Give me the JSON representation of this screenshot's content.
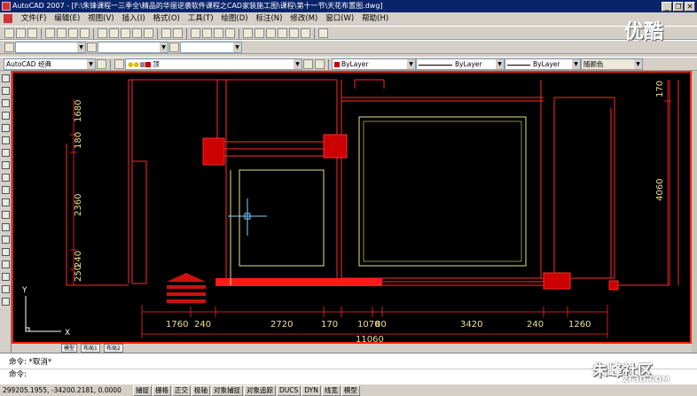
{
  "window": {
    "title": "AutoCAD 2007 - [F:\\朱锋课程一三季全\\精品的华丽逆袭软件课程之CAD家装施工图\\课程\\第十一节\\天花布置图.dwg]",
    "minimize_glyph": "_",
    "restore_glyph": "❐",
    "close_glyph": "✕"
  },
  "menu": {
    "items": [
      "文件(F)",
      "编辑(E)",
      "视图(V)",
      "插入(I)",
      "格式(O)",
      "工具(T)",
      "绘图(D)",
      "标注(N)",
      "修改(M)",
      "窗口(W)",
      "帮助(H)"
    ]
  },
  "properties_bar": {
    "workspace": "AutoCAD 经典",
    "layer": "顶",
    "color": "ByLayer",
    "linetype": "ByLayer",
    "lineweight": "ByLayer",
    "plotstyle": "随颜色",
    "layer_color": "#cc0000"
  },
  "drawing": {
    "dims_left": [
      "1680",
      "180",
      "2360",
      "240",
      "250"
    ],
    "dims_right": [
      "170",
      "4060"
    ],
    "dims_bottom": [
      "1760",
      "240",
      "2720",
      "170",
      "1070",
      "80",
      "3420",
      "240",
      "1260"
    ],
    "total_width": "11060",
    "ucs_x": "X",
    "ucs_y": "Y"
  },
  "tabs": [
    "模型",
    "布局1",
    "布局2"
  ],
  "command": {
    "history": "命令: *取消*",
    "prompt": "命令:"
  },
  "status": {
    "coordinates": "299205.1955, -34200.2181, 0.0000",
    "buttons": [
      "捕捉",
      "栅格",
      "正交",
      "极轴",
      "对象捕捉",
      "对象追踪",
      "DUCS",
      "DYN",
      "线宽",
      "模型"
    ]
  },
  "watermarks": {
    "top_right": "优酷",
    "bottom_right": "朱峰社区",
    "bottom_right_sub": "ZF3D.COM"
  }
}
